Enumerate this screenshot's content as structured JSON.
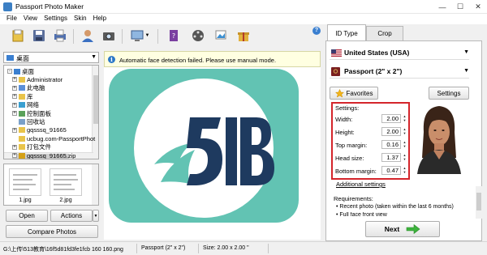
{
  "window": {
    "title": "Passport Photo Maker"
  },
  "menu": [
    "File",
    "View",
    "Settings",
    "Skin",
    "Help"
  ],
  "toolbar": {
    "icons": [
      "open-folder-icon",
      "save-icon",
      "print-icon",
      "user-contacts-icon",
      "camera-icon",
      "monitor-icon",
      "help-book-icon",
      "film-reel-icon",
      "photo-stack-icon",
      "gift-box-icon"
    ]
  },
  "left": {
    "folder_path": "桌面",
    "tree": [
      {
        "label": "桌面",
        "level": 0,
        "exp": "-"
      },
      {
        "label": "Administrator",
        "level": 1,
        "exp": "+"
      },
      {
        "label": "此电脑",
        "level": 1,
        "exp": "+"
      },
      {
        "label": "库",
        "level": 1,
        "exp": "+"
      },
      {
        "label": "网络",
        "level": 1,
        "exp": "+"
      },
      {
        "label": "控制面板",
        "level": 1,
        "exp": "+"
      },
      {
        "label": "回收站",
        "level": 1,
        "exp": ""
      },
      {
        "label": "gqsssq_91665",
        "level": 1,
        "exp": "+"
      },
      {
        "label": "ucbug.com-PassportPhot",
        "level": 1,
        "exp": ""
      },
      {
        "label": "打包文件",
        "level": 1,
        "exp": "+"
      },
      {
        "label": "gqsssq_91665.zip",
        "level": 1,
        "exp": "+"
      }
    ],
    "thumbnails": [
      "1.jpg",
      "2.jpg"
    ],
    "open_label": "Open",
    "actions_label": "Actions",
    "compare_label": "Compare Photos"
  },
  "center": {
    "info_icon": "i",
    "info_text": "Automatic face detection failed. Please use manual mode."
  },
  "status": {
    "path": "G:\\上传\\513教育\\16f5d81fd3fe1fcb 160 160.png",
    "format": "Passport (2\" x 2\")",
    "size": "Size: 2.00 x 2.00 \""
  },
  "right": {
    "help_icon": "?",
    "tabs": [
      "ID Type",
      "Crop"
    ],
    "active_tab": "ID Type",
    "country": "United States (USA)",
    "document": "Passport (2\" x 2\")",
    "favorites_label": "Favorites",
    "settings_button_label": "Settings",
    "settings_header": "Settings:",
    "settings": [
      {
        "label": "Width:",
        "value": "2.00"
      },
      {
        "label": "Height:",
        "value": "2.00"
      },
      {
        "label": "Top margin:",
        "value": "0.16"
      },
      {
        "label": "Head size:",
        "value": "1.37"
      },
      {
        "label": "Bottom margin:",
        "value": "0.47"
      }
    ],
    "additional_settings": "Additional settings",
    "requirements_label": "Requirements:",
    "requirements": [
      "• Recent photo (taken within the last 6 months)",
      "• Full face front view"
    ],
    "next_label": "Next"
  },
  "colors": {
    "logo_teal": "#62c3b3",
    "logo_blue": "#1e3a5f",
    "highlight": "#d4252b",
    "next_arrow": "#3db33d"
  }
}
